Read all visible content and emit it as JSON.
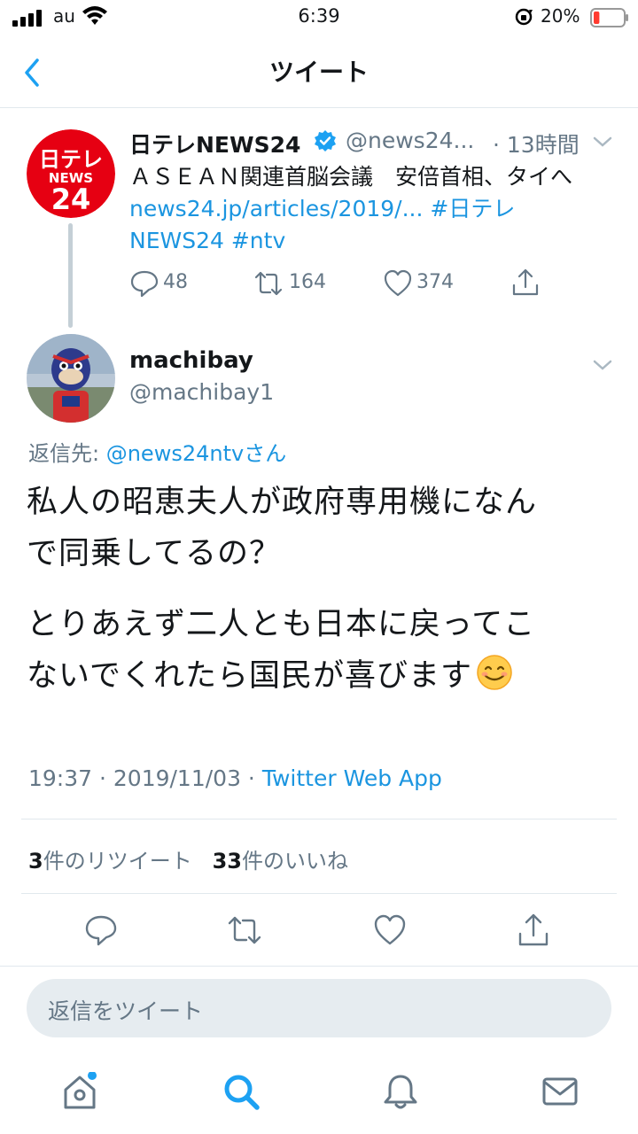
{
  "status_bar": {
    "carrier": "au",
    "time": "6:39",
    "battery_pct": "20%",
    "battery_level": 0.2
  },
  "nav": {
    "title": "ツイート",
    "back_icon": "chevron-left-icon"
  },
  "parent_tweet": {
    "name": "日テレNEWS24",
    "verified": true,
    "handle": "@news24...",
    "time": "· 13時間",
    "text_line1": "ＡＳＥＡＮ関連首脳会議　安倍首相、タイへ",
    "link": "news24.jp/articles/2019/...",
    "hashtag1": "#日テレ",
    "hashtag1b": "NEWS24",
    "hashtag2": "#ntv",
    "replies": "48",
    "retweets": "164",
    "likes": "374",
    "avatar_text_top": "日テレ",
    "avatar_text_mid": "NEWS",
    "avatar_text_bottom": "24"
  },
  "tweet": {
    "name": "machibay",
    "handle": "@machibay1",
    "reply_to_label": "返信先: ",
    "reply_to_handle": "@news24ntvさん",
    "body_line1": "私人の昭恵夫人が政府専用機になん",
    "body_line2": "で同乗してるの？",
    "body_line3": "とりあえず二人とも日本に戻ってこ",
    "body_line4": "ないでくれたら国民が喜びます",
    "timestamp": "19:37 · 2019/11/03 · ",
    "source": "Twitter Web App",
    "retweet_count": "3",
    "retweet_label": "件のリツイート",
    "like_count": "33",
    "like_label": "件のいいね"
  },
  "reply_bar": {
    "placeholder": "返信をツイート"
  },
  "tabs": [
    "home-icon",
    "search-icon",
    "notifications-icon",
    "messages-icon"
  ],
  "colors": {
    "accent": "#1da1f2",
    "link": "#1b95e0",
    "secondary_text": "#657786",
    "battery_low": "#ff3b30"
  }
}
